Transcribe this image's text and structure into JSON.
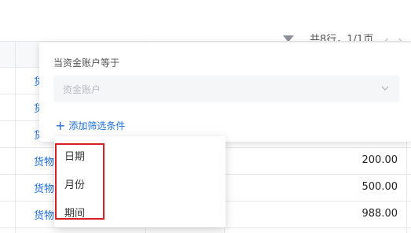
{
  "toolbar": {
    "paging_text": "共8行，1/1页",
    "prev_icon": "chevron-left-icon",
    "next_icon": "chevron-right-icon",
    "filter_icon": "filter-icon"
  },
  "table": {
    "rows": [
      {
        "type": "货物",
        "amount": ""
      },
      {
        "type": "货物",
        "amount": ""
      },
      {
        "type": "货物",
        "amount": ""
      },
      {
        "type": "货物",
        "amount": "200.00"
      },
      {
        "type": "货物",
        "amount": "500.00"
      },
      {
        "type": "货物",
        "amount": "988.00"
      }
    ]
  },
  "filter_panel": {
    "condition_label": "当资金账户等于",
    "select_placeholder": "资金账户",
    "add_condition": "添加筛选条件"
  },
  "dropdown": {
    "items": [
      "日期",
      "月份",
      "期间"
    ]
  },
  "colors": {
    "accent": "#1f6fd8",
    "highlight": "#d61f26"
  }
}
